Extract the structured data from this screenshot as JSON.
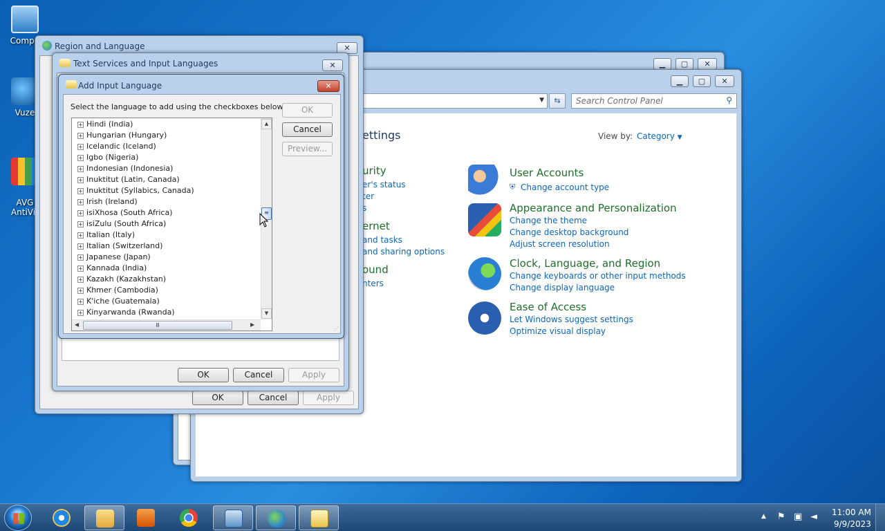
{
  "desktop": {
    "icons": [
      {
        "label": "Compu"
      },
      {
        "label": "Vuze"
      },
      {
        "label": "AVG\nAntiVir"
      }
    ]
  },
  "control_panel": {
    "search_placeholder": "Search Control Panel",
    "heading_partial": "ettings",
    "view_by_label": "View by:",
    "view_by_value": "Category",
    "left_partial": [
      {
        "text": "urity",
        "kind": "head"
      },
      {
        "text": "er's status",
        "kind": "link"
      },
      {
        "text": "ter",
        "kind": "link"
      },
      {
        "text": "s",
        "kind": "link"
      },
      {
        "text": "ernet",
        "kind": "head"
      },
      {
        "text": "and tasks",
        "kind": "link"
      },
      {
        "text": "and sharing options",
        "kind": "link"
      },
      {
        "text": "ound",
        "kind": "head"
      },
      {
        "text": "nters",
        "kind": "link"
      }
    ],
    "categories": [
      {
        "title": "User Accounts",
        "links": [
          "Change account type"
        ]
      },
      {
        "title": "Appearance and Personalization",
        "links": [
          "Change the theme",
          "Change desktop background",
          "Adjust screen resolution"
        ]
      },
      {
        "title": "Clock, Language, and Region",
        "links": [
          "Change keyboards or other input methods",
          "Change display language"
        ]
      },
      {
        "title": "Ease of Access",
        "links": [
          "Let Windows suggest settings",
          "Optimize visual display"
        ]
      }
    ]
  },
  "region_window": {
    "title": "Region and Language",
    "ok": "OK",
    "cancel": "Cancel",
    "apply": "Apply"
  },
  "text_services_window": {
    "title": "Text Services and Input Languages",
    "ok": "OK",
    "cancel": "Cancel",
    "apply": "Apply"
  },
  "add_input_dialog": {
    "title": "Add Input Language",
    "instruction": "Select the language to add using the checkboxes below.",
    "ok": "OK",
    "cancel": "Cancel",
    "preview": "Preview...",
    "languages": [
      "Hindi (India)",
      "Hungarian (Hungary)",
      "Icelandic (Iceland)",
      "Igbo (Nigeria)",
      "Indonesian (Indonesia)",
      "Inuktitut (Latin, Canada)",
      "Inuktitut (Syllabics, Canada)",
      "Irish (Ireland)",
      "isiXhosa (South Africa)",
      "isiZulu (South Africa)",
      "Italian (Italy)",
      "Italian (Switzerland)",
      "Japanese (Japan)",
      "Kannada (India)",
      "Kazakh (Kazakhstan)",
      "Khmer (Cambodia)",
      "K'iche (Guatemala)",
      "Kinyarwanda (Rwanda)"
    ]
  },
  "taskbar": {
    "time": "11:00 AM",
    "date": "9/9/2023"
  }
}
